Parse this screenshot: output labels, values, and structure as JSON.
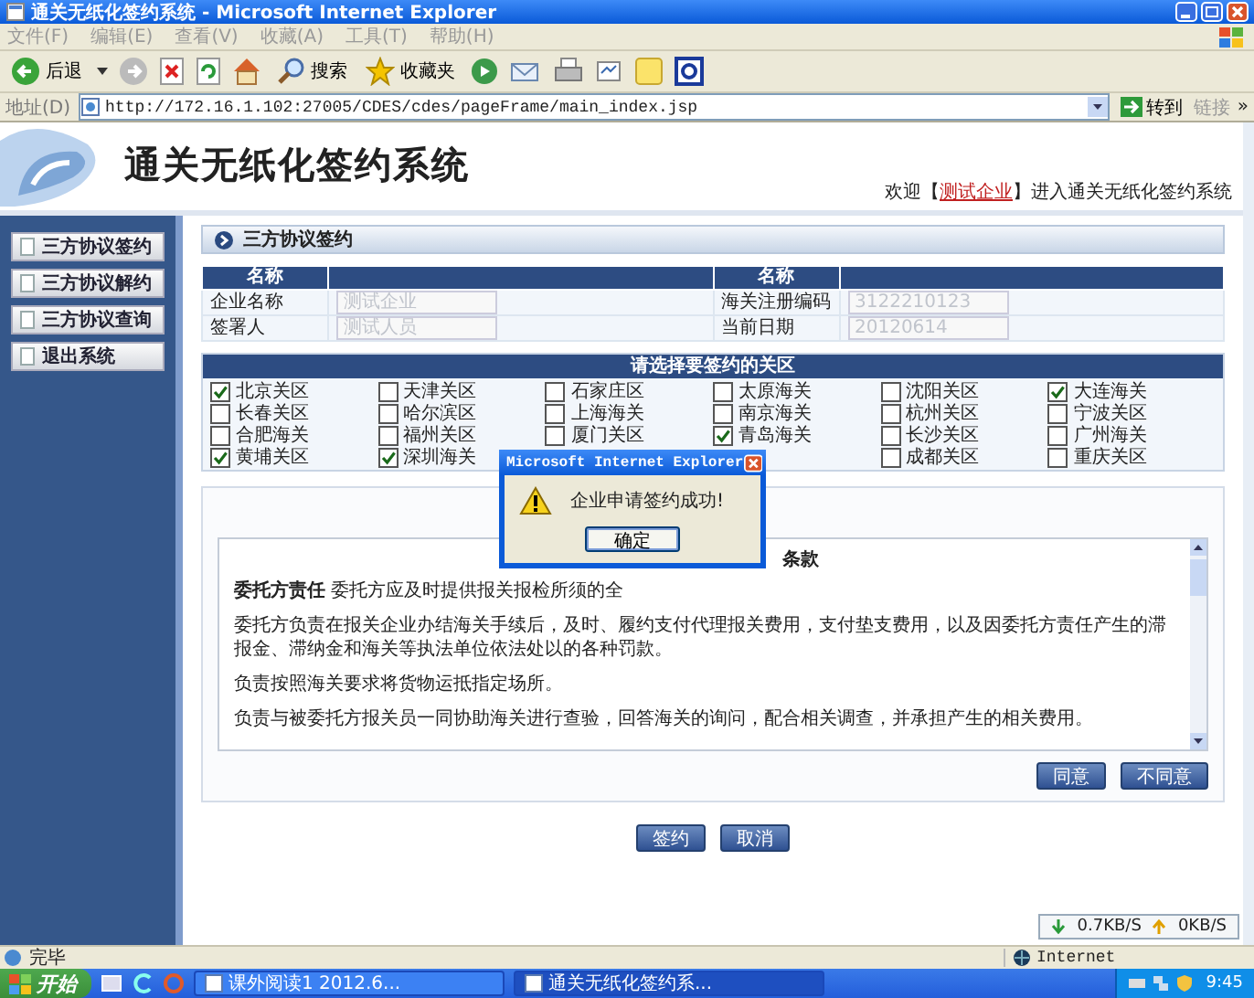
{
  "window": {
    "title": "通关无纸化签约系统 - Microsoft Internet Explorer"
  },
  "menu": [
    "文件(F)",
    "编辑(E)",
    "查看(V)",
    "收藏(A)",
    "工具(T)",
    "帮助(H)"
  ],
  "toolbar": {
    "back": "后退",
    "search": "搜索",
    "favorites": "收藏夹"
  },
  "address": {
    "label": "地址(D)",
    "url": "http://172.16.1.102:27005/CDES/cdes/pageFrame/main_index.jsp",
    "go": "转到",
    "links": "链接",
    "more": "»"
  },
  "header": {
    "title": "通关无纸化签约系统",
    "welcome_prefix": "欢迎【",
    "user": "测试企业",
    "welcome_suffix": "】进入通关无纸化签约系统"
  },
  "sidebar": {
    "items": [
      "三方协议签约",
      "三方协议解约",
      "三方协议查询",
      "退出系统"
    ]
  },
  "panel": {
    "title": "三方协议签约"
  },
  "form": {
    "headers": [
      "名称",
      "名称"
    ],
    "rows": [
      [
        {
          "label": "企业名称",
          "value": "测试企业",
          "disabled": true
        },
        {
          "label": "海关注册编码",
          "value": "3122210123",
          "disabled": true
        }
      ],
      [
        {
          "label": "签署人",
          "value": "测试人员",
          "disabled": true
        },
        {
          "label": "当前日期",
          "value": "20120614",
          "disabled": true
        }
      ]
    ]
  },
  "districts": {
    "title": "请选择要签约的关区",
    "items": [
      {
        "label": "北京关区",
        "checked": true
      },
      {
        "label": "天津关区",
        "checked": false
      },
      {
        "label": "石家庄区",
        "checked": false
      },
      {
        "label": "太原海关",
        "checked": false
      },
      {
        "label": "沈阳关区",
        "checked": false
      },
      {
        "label": "大连海关",
        "checked": true
      },
      {
        "label": "长春关区",
        "checked": false
      },
      {
        "label": "哈尔滨区",
        "checked": false
      },
      {
        "label": "上海海关",
        "checked": false
      },
      {
        "label": "南京海关",
        "checked": false
      },
      {
        "label": "杭州关区",
        "checked": false
      },
      {
        "label": "宁波关区",
        "checked": false
      },
      {
        "label": "合肥海关",
        "checked": false
      },
      {
        "label": "福州关区",
        "checked": false
      },
      {
        "label": "厦门关区",
        "checked": false
      },
      {
        "label": "青岛海关",
        "checked": true
      },
      {
        "label": "长沙关区",
        "checked": false
      },
      {
        "label": "广州海关",
        "checked": false
      },
      {
        "label": "黄埔关区",
        "checked": true
      },
      {
        "label": "深圳海关",
        "checked": true
      },
      {
        "label": "成都关区",
        "checked": false
      },
      {
        "label": "重庆关区",
        "checked": false
      }
    ]
  },
  "agreement": {
    "heading": "条款",
    "paragraphs": [
      "**委托方责任** 委托方应及时提供报关报检所须的全",
      "委托方负责在报关企业办结海关手续后，及时、履约支付代理报关费用，支付垫支费用，以及因委托方责任产生的滞报金、滞纳金和海关等执法单位依法处以的各种罚款。",
      "负责按照海关要求将货物运抵指定场所。",
      "负责与被委托方报关员一同协助海关进行查验，回答海关的询问，配合相关调查，并承担产生的相关费用。"
    ],
    "buttons": [
      "同意",
      "不同意"
    ]
  },
  "actions": [
    "签约",
    "取消"
  ],
  "network": {
    "down": "0.7KB/S",
    "up": "0KB/S"
  },
  "dialog": {
    "title": "Microsoft Internet Explorer",
    "message": "企业申请签约成功!",
    "button": "确定"
  },
  "status_bar": {
    "text": "完毕",
    "zone": "Internet"
  },
  "taskbar": {
    "start": "开始",
    "tasks": [
      {
        "label": "课外阅读1 2012.6...",
        "selected": false
      },
      {
        "label": "通关无纸化签约系...",
        "selected": true
      }
    ],
    "clock": "9:45"
  }
}
